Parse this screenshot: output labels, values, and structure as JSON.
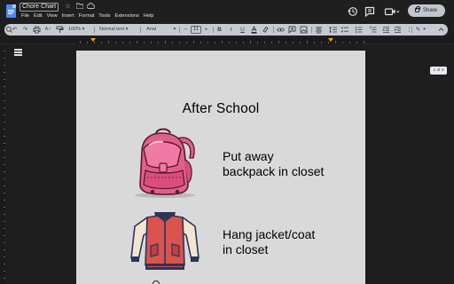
{
  "app": {
    "title": "Chore Chart",
    "menu": [
      "File",
      "Edit",
      "View",
      "Insert",
      "Format",
      "Tools",
      "Extensions",
      "Help"
    ],
    "share_label": "Share"
  },
  "toolbar": {
    "zoom": "100%",
    "style": "Normal text",
    "font": "Arial",
    "font_size": "11"
  },
  "page_indicator": "1 of 3",
  "document": {
    "heading": "After School",
    "items": [
      {
        "line1": "Put away",
        "line2": "backpack in closet",
        "illustration": "backpack-icon"
      },
      {
        "line1": "Hang jacket/coat",
        "line2": "in closet",
        "illustration": "jacket-icon"
      }
    ]
  },
  "colors": {
    "accent": "#4c8bf5",
    "page": "#d9d9d9",
    "toolbar": "#c6cad2",
    "backpack_pink": "#e0608c",
    "jacket_red": "#d9534f",
    "jacket_cream": "#f2e6d0",
    "jacket_navy": "#2b3556"
  }
}
